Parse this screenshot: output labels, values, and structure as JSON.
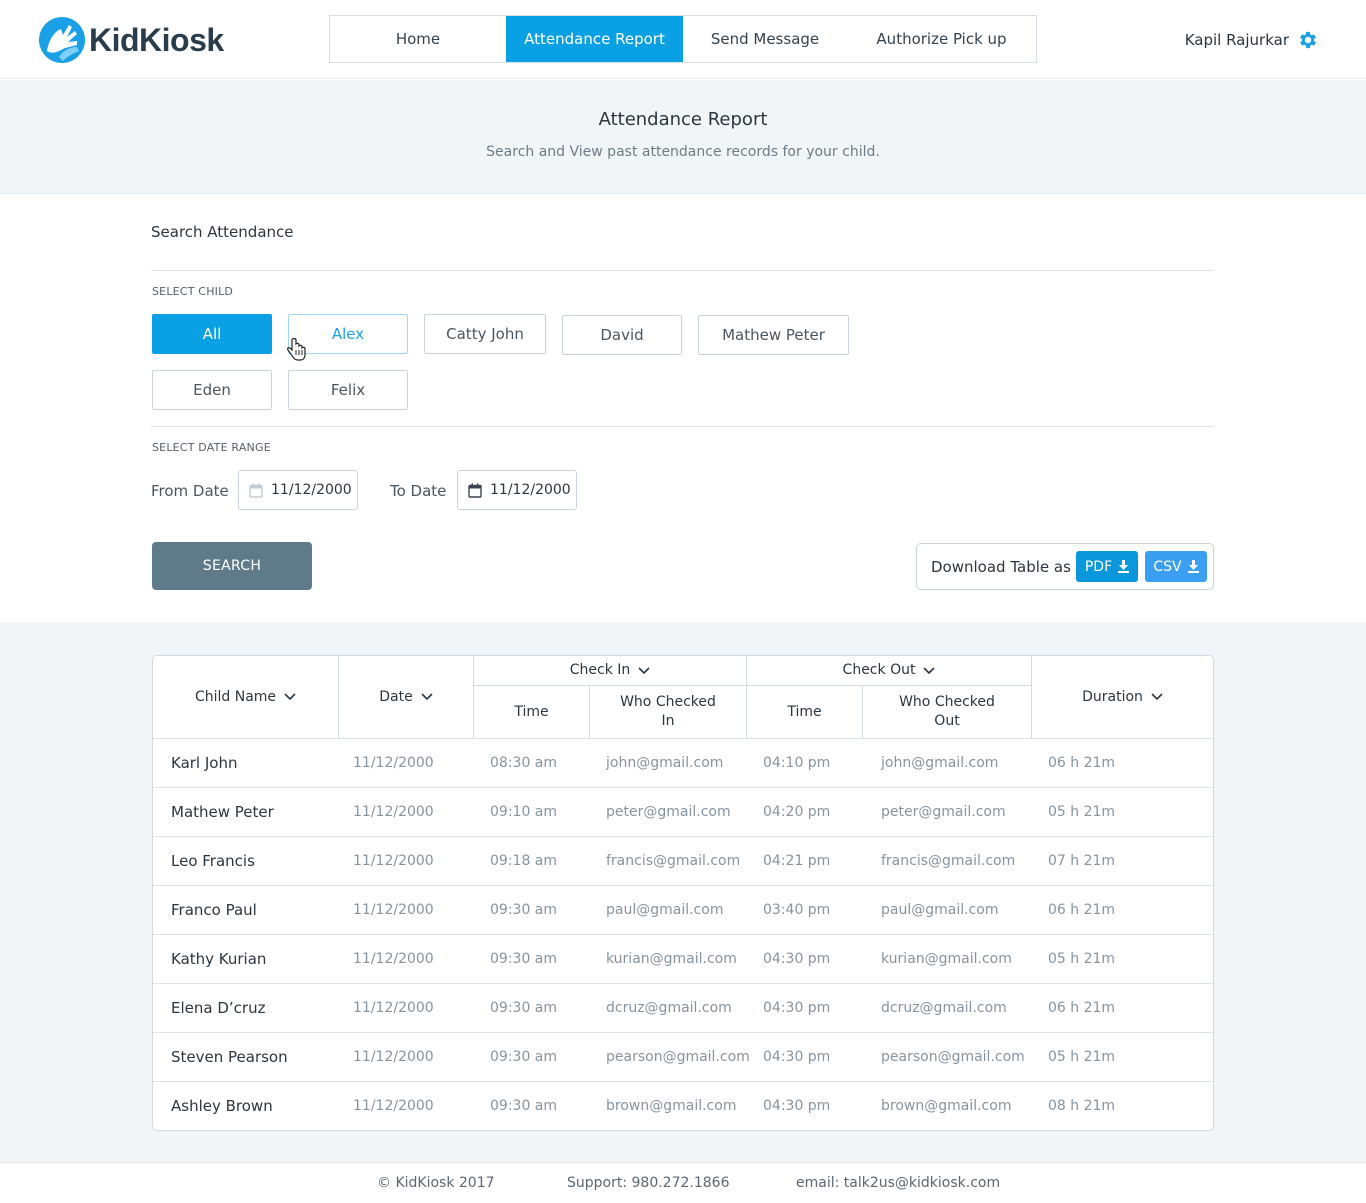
{
  "brand": {
    "name": "KidKiosk"
  },
  "nav": {
    "items": [
      {
        "label": "Home"
      },
      {
        "label": "Attendance Report"
      },
      {
        "label": "Send Message"
      },
      {
        "label": "Authorize Pick up"
      }
    ],
    "active_index": 1
  },
  "user": {
    "name": "Kapil Rajurkar",
    "icon": "gear-icon"
  },
  "banner": {
    "title": "Attendance Report",
    "subtitle": "Search and View past attendance records for your child."
  },
  "search": {
    "title": "Search Attendance",
    "select_child_label": "SELECT CHILD",
    "children": [
      "All",
      "Alex",
      "Catty John",
      "David",
      "Mathew Peter",
      "Eden",
      "Felix"
    ],
    "selected_child": "All",
    "hovered_child": "Alex",
    "date_range_label": "SELECT DATE RANGE",
    "from_label": "From Date",
    "from_value": "11/12/2000",
    "to_label": "To Date",
    "to_value": "11/12/2000",
    "search_button": "SEARCH"
  },
  "download": {
    "label": "Download Table as",
    "pdf": "PDF",
    "csv": "CSV",
    "colors": {
      "pdf": "#0a97dc",
      "csv": "#3a9ff0"
    }
  },
  "table": {
    "headers": {
      "child_name": "Child Name",
      "date": "Date",
      "check_in": "Check In",
      "check_in_time": "Time",
      "check_in_who": "Who Checked In",
      "check_out": "Check Out",
      "check_out_time": "Time",
      "check_out_who": "Who Checked Out",
      "duration": "Duration"
    },
    "rows": [
      {
        "name": "Karl John",
        "date": "11/12/2000",
        "in_time": "08:30 am",
        "in_who": "john@gmail.com",
        "out_time": "04:10 pm",
        "out_who": "john@gmail.com",
        "duration": "06 h 21m"
      },
      {
        "name": "Mathew Peter",
        "date": "11/12/2000",
        "in_time": "09:10 am",
        "in_who": "peter@gmail.com",
        "out_time": "04:20 pm",
        "out_who": "peter@gmail.com",
        "duration": "05 h 21m"
      },
      {
        "name": "Leo Francis",
        "date": "11/12/2000",
        "in_time": "09:18 am",
        "in_who": "francis@gmail.com",
        "out_time": "04:21 pm",
        "out_who": "francis@gmail.com",
        "duration": "07 h 21m"
      },
      {
        "name": "Franco Paul",
        "date": "11/12/2000",
        "in_time": "09:30 am",
        "in_who": "paul@gmail.com",
        "out_time": "03:40 pm",
        "out_who": "paul@gmail.com",
        "duration": "06 h 21m"
      },
      {
        "name": "Kathy Kurian",
        "date": "11/12/2000",
        "in_time": "09:30 am",
        "in_who": "kurian@gmail.com",
        "out_time": "04:30 pm",
        "out_who": "kurian@gmail.com",
        "duration": "05 h 21m"
      },
      {
        "name": "Elena D’cruz",
        "date": "11/12/2000",
        "in_time": "09:30 am",
        "in_who": "dcruz@gmail.com",
        "out_time": "04:30 pm",
        "out_who": "dcruz@gmail.com",
        "duration": "06 h 21m"
      },
      {
        "name": "Steven Pearson",
        "date": "11/12/2000",
        "in_time": "09:30 am",
        "in_who": "pearson@gmail.com",
        "out_time": "04:30 pm",
        "out_who": "pearson@gmail.com",
        "duration": "05 h 21m"
      },
      {
        "name": "Ashley Brown",
        "date": "11/12/2000",
        "in_time": "09:30 am",
        "in_who": "brown@gmail.com",
        "out_time": "04:30 pm",
        "out_who": "brown@gmail.com",
        "duration": "08 h 21m"
      }
    ]
  },
  "footer": {
    "copyright": "© KidKiosk 2017",
    "support": "Support: 980.272.1866",
    "email": "email: talk2us@kidkiosk.com"
  },
  "colors": {
    "accent": "#0aa0e4",
    "search_button": "#5f7a89"
  }
}
